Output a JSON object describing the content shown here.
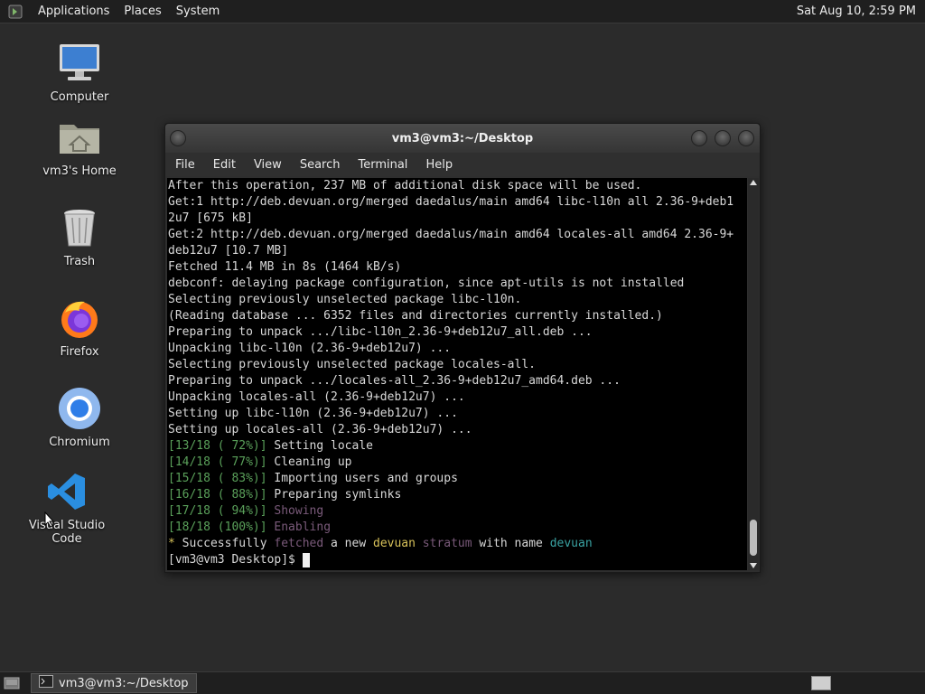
{
  "top_panel": {
    "menus": [
      "Applications",
      "Places",
      "System"
    ],
    "clock": "Sat Aug 10,  2:59 PM"
  },
  "desktop_icons": [
    {
      "label": "Computer",
      "icon": "computer-icon"
    },
    {
      "label": "vm3's Home",
      "icon": "home-folder-icon"
    },
    {
      "label": "Trash",
      "icon": "trash-icon"
    },
    {
      "label": "Firefox",
      "icon": "firefox-icon"
    },
    {
      "label": "Chromium",
      "icon": "chromium-icon"
    },
    {
      "label": "Visual Studio Code",
      "icon": "vscode-icon"
    }
  ],
  "window": {
    "title": "vm3@vm3:~/Desktop",
    "menus": [
      "File",
      "Edit",
      "View",
      "Search",
      "Terminal",
      "Help"
    ]
  },
  "terminal": {
    "lines": [
      "After this operation, 237 MB of additional disk space will be used.",
      "Get:1 http://deb.devuan.org/merged daedalus/main amd64 libc-l10n all 2.36-9+deb1",
      "2u7 [675 kB]",
      "Get:2 http://deb.devuan.org/merged daedalus/main amd64 locales-all amd64 2.36-9+",
      "deb12u7 [10.7 MB]",
      "Fetched 11.4 MB in 8s (1464 kB/s)",
      "debconf: delaying package configuration, since apt-utils is not installed",
      "Selecting previously unselected package libc-l10n.",
      "(Reading database ... 6352 files and directories currently installed.)",
      "Preparing to unpack .../libc-l10n_2.36-9+deb12u7_all.deb ...",
      "Unpacking libc-l10n (2.36-9+deb12u7) ...",
      "Selecting previously unselected package locales-all.",
      "Preparing to unpack .../locales-all_2.36-9+deb12u7_amd64.deb ...",
      "Unpacking locales-all (2.36-9+deb12u7) ...",
      "Setting up libc-l10n (2.36-9+deb12u7) ...",
      "Setting up locales-all (2.36-9+deb12u7) ..."
    ],
    "progress": [
      {
        "tag": "[13/18 ( 72%)]",
        "text": "Setting locale",
        "dim": false
      },
      {
        "tag": "[14/18 ( 77%)]",
        "text": "Cleaning up",
        "dim": false
      },
      {
        "tag": "[15/18 ( 83%)]",
        "text": "Importing users and groups",
        "dim": false
      },
      {
        "tag": "[16/18 ( 88%)]",
        "text": "Preparing symlinks",
        "dim": false
      },
      {
        "tag": "[17/18 ( 94%)]",
        "text": "Showing",
        "dim": true
      },
      {
        "tag": "[18/18 (100%)]",
        "text": "Enabling",
        "dim": true
      }
    ],
    "success": {
      "star": "*",
      "p1": " Successfully ",
      "w1": "fetched",
      "p2": " a new ",
      "w2": "devuan",
      "p3": " ",
      "w3": "stratum",
      "p4": " with name ",
      "w4": "devuan"
    },
    "prompt": "[vm3@vm3 Desktop]$ "
  },
  "taskbar": {
    "task_label": "vm3@vm3:~/Desktop"
  },
  "colors": {
    "progress_tag": "#5aa05a",
    "dim": "#7a5a7a",
    "highlight": "#d8c25a",
    "teal": "#3aa3a3"
  }
}
